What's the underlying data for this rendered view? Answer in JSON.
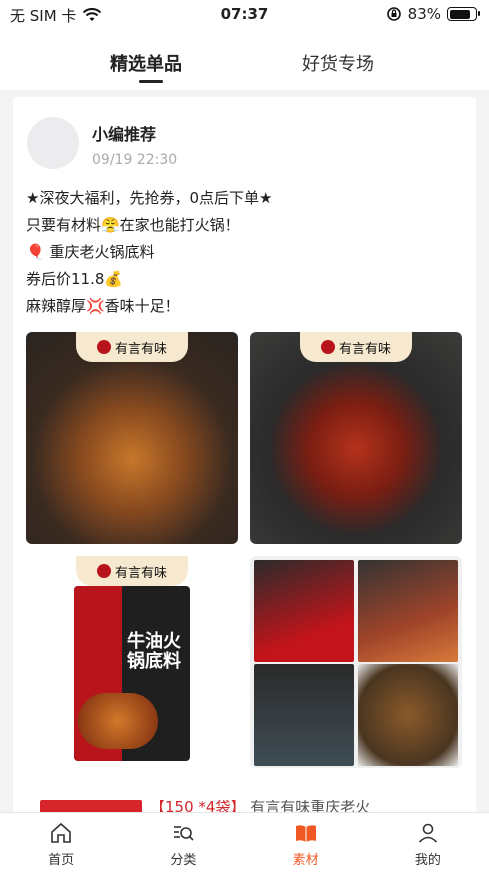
{
  "status_bar": {
    "carrier": "无 SIM 卡",
    "time": "07:37",
    "battery": "83%",
    "battery_level": 0.83,
    "wifi_icon": "wifi-icon",
    "rotation_lock_icon": "rotation-lock-icon"
  },
  "tabs": [
    {
      "label": "精选单品",
      "active": true
    },
    {
      "label": "好货专场",
      "active": false
    }
  ],
  "post": {
    "author": "小编推荐",
    "time": "09/19 22:30",
    "lines": [
      "★深夜大福利，先抢券，0点后下单★",
      "只要有材料😤在家也能打火锅！",
      "🎈 重庆老火锅底料",
      "券后价11.8💰",
      "麻辣醇厚💢香味十足！"
    ],
    "brand_badge": "有言有味",
    "package_title": "牛油火锅底料"
  },
  "next_item": {
    "tag": "【150 *4袋】",
    "text": "有言有味重庆老火"
  },
  "bottom_nav": [
    {
      "label": "首页",
      "icon": "home-icon",
      "active": false
    },
    {
      "label": "分类",
      "icon": "category-search-icon",
      "active": false
    },
    {
      "label": "素材",
      "icon": "material-book-icon",
      "active": true
    },
    {
      "label": "我的",
      "icon": "profile-icon",
      "active": false
    }
  ],
  "colors": {
    "accent": "#ef5a24",
    "brand_red": "#b8141c"
  }
}
